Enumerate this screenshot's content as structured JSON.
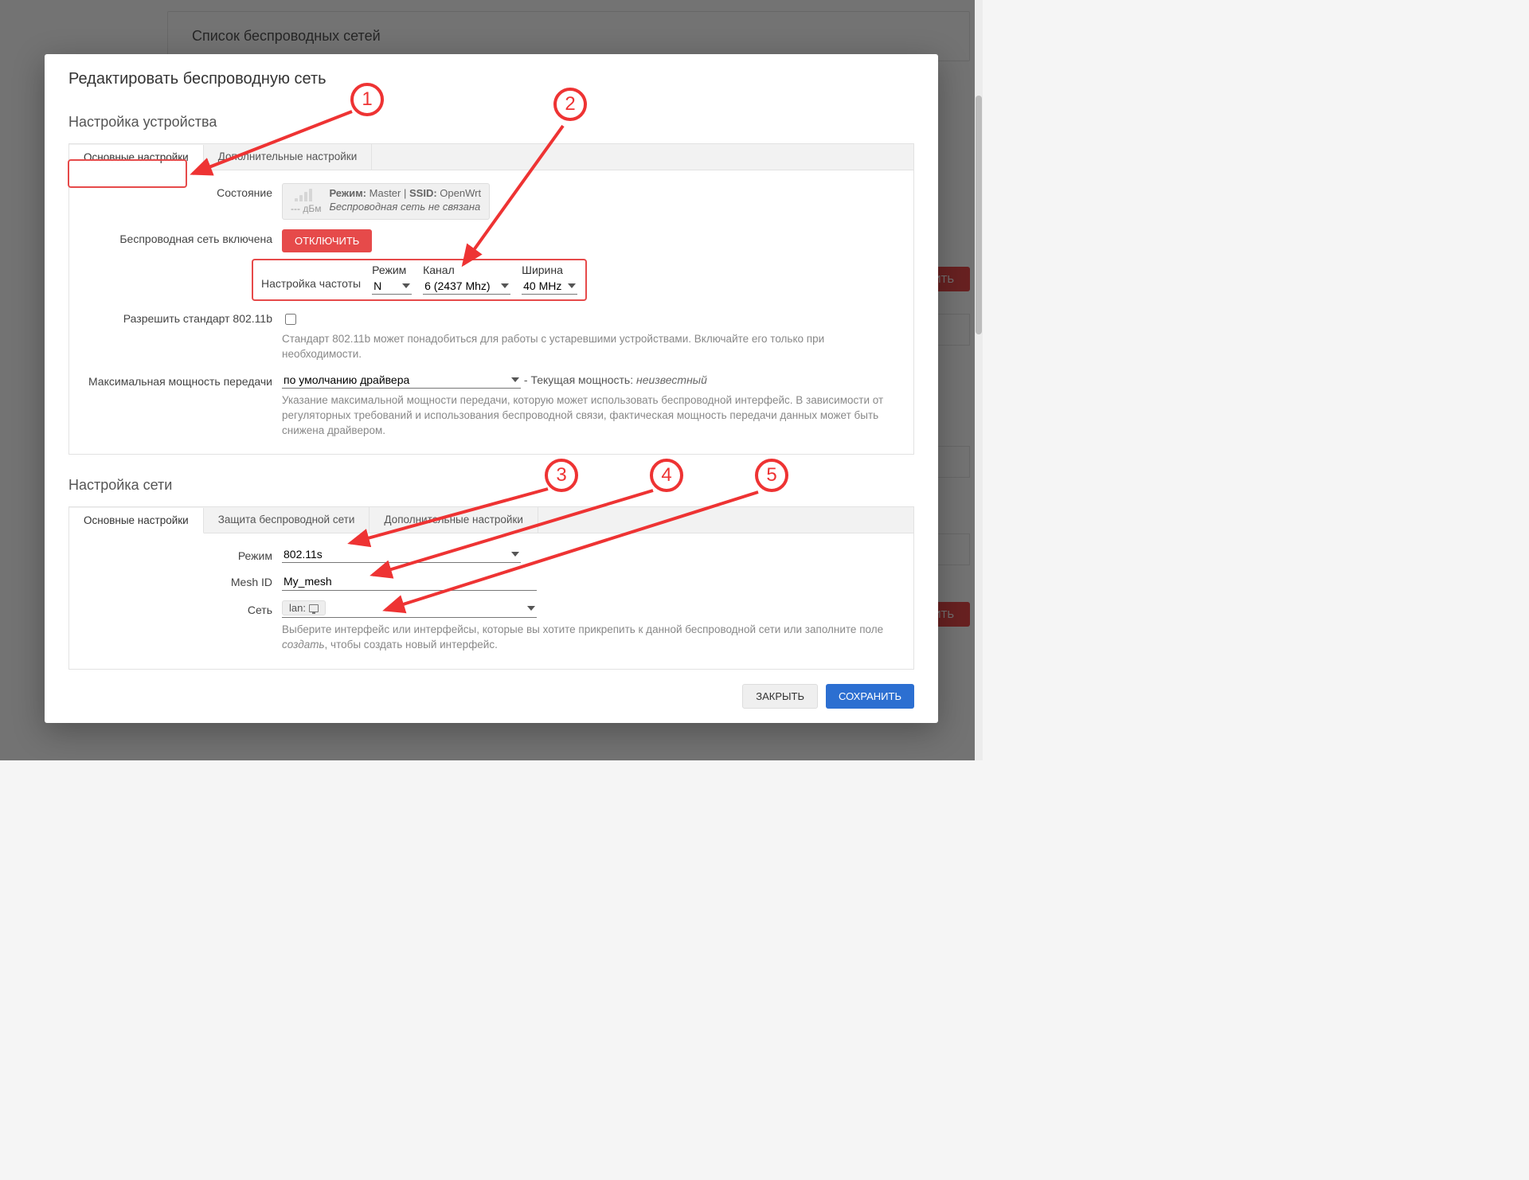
{
  "background": {
    "page_header": "Список беспроводных сетей",
    "action_button": "…ТИТЬ"
  },
  "modal": {
    "title": "Редактировать беспроводную сеть",
    "device_section_title": "Настройка устройства",
    "device_tabs": {
      "general": "Основные настройки",
      "advanced": "Дополнительные настройки"
    },
    "fields": {
      "status_label": "Состояние",
      "status_signal": "--- дБм",
      "status_mode_label": "Режим:",
      "status_mode_value": "Master",
      "status_ssid_label": "SSID:",
      "status_ssid_value": "OpenWrt",
      "status_note": "Беспроводная сеть не связана",
      "wireless_enabled_label": "Беспроводная сеть включена",
      "disable_button": "ОТКЛЮЧИТЬ",
      "freq_label": "Настройка частоты",
      "freq_mode_title": "Режим",
      "freq_mode_value": "N",
      "freq_channel_title": "Канал",
      "freq_channel_value": "6 (2437 Mhz)",
      "freq_width_title": "Ширина",
      "freq_width_value": "40 MHz",
      "legacy_label": "Разрешить стандарт 802.11b",
      "legacy_hint": "Стандарт 802.11b может понадобиться для работы с устаревшими устройствами. Включайте его только при необходимости.",
      "txpower_label": "Максимальная мощность передачи",
      "txpower_value": "по умолчанию драйвера",
      "txpower_current_prefix": "- Текущая мощность:",
      "txpower_current_value": "неизвестный",
      "txpower_hint": "Указание максимальной мощности передачи, которую может использовать беспроводной интерфейс. В зависимости от регуляторных требований и использования беспроводной связи, фактическая мощность передачи данных может быть снижена драйвером."
    },
    "network_section_title": "Настройка сети",
    "network_tabs": {
      "general": "Основные настройки",
      "security": "Защита беспроводной сети",
      "advanced": "Дополнительные настройки"
    },
    "network_fields": {
      "mode_label": "Режим",
      "mode_value": "802.11s",
      "mesh_id_label": "Mesh ID",
      "mesh_id_value": "My_mesh",
      "network_label": "Сеть",
      "network_value": "lan:",
      "network_hint_1": "Выберите интерфейс или интерфейсы, которые вы хотите прикрепить к данной беспроводной сети или заполните поле ",
      "network_hint_em": "создать",
      "network_hint_2": ", чтобы создать новый интерфейс."
    },
    "footer": {
      "close": "ЗАКРЫТЬ",
      "save": "СОХРАНИТЬ"
    }
  },
  "annotations": {
    "n1": "1",
    "n2": "2",
    "n3": "3",
    "n4": "4",
    "n5": "5"
  }
}
